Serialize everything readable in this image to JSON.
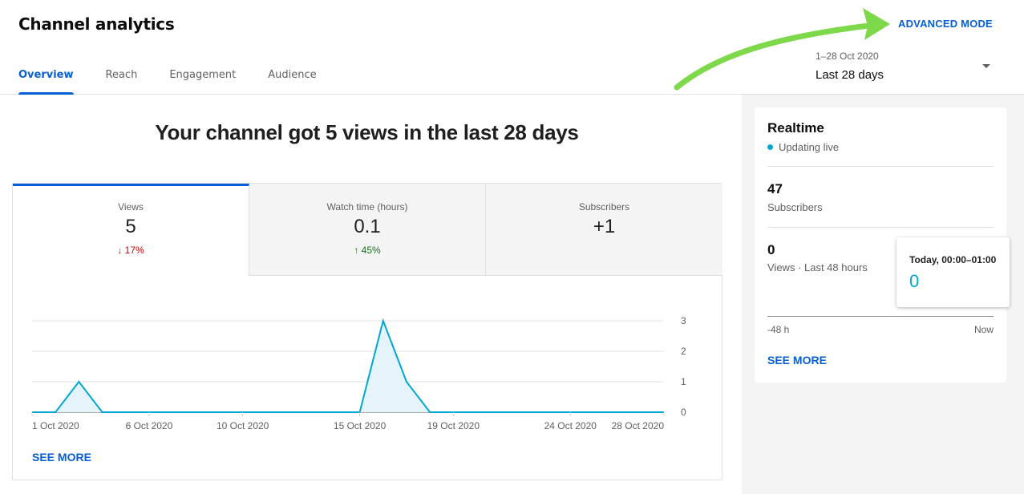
{
  "header": {
    "title": "Channel analytics",
    "tabs": [
      {
        "label": "Overview",
        "active": true
      },
      {
        "label": "Reach",
        "active": false
      },
      {
        "label": "Engagement",
        "active": false
      },
      {
        "label": "Audience",
        "active": false
      }
    ],
    "advanced_mode_label": "ADVANCED MODE",
    "date_range": {
      "dates": "1–28 Oct 2020",
      "selected": "Last 28 days"
    },
    "annotation_color": "#7dd84a"
  },
  "main": {
    "headline": "Your channel got 5 views in the last 28 days",
    "metrics": [
      {
        "label": "Views",
        "value": "5",
        "delta": "17%",
        "direction": "down",
        "active": true
      },
      {
        "label": "Watch time (hours)",
        "value": "0.1",
        "delta": "45%",
        "direction": "up",
        "active": false
      },
      {
        "label": "Subscribers",
        "value": "+1",
        "delta": "",
        "direction": "",
        "active": false
      }
    ],
    "see_more": "SEE MORE"
  },
  "chart_data": {
    "type": "area",
    "title": "",
    "xlabel": "",
    "ylabel": "Views",
    "x": [
      "1 Oct",
      "2 Oct",
      "3 Oct",
      "4 Oct",
      "5 Oct",
      "6 Oct",
      "7 Oct",
      "8 Oct",
      "9 Oct",
      "10 Oct",
      "11 Oct",
      "12 Oct",
      "13 Oct",
      "14 Oct",
      "15 Oct",
      "16 Oct",
      "17 Oct",
      "18 Oct",
      "19 Oct",
      "20 Oct",
      "21 Oct",
      "22 Oct",
      "23 Oct",
      "24 Oct",
      "25 Oct",
      "26 Oct",
      "27 Oct",
      "28 Oct"
    ],
    "values": [
      0,
      0,
      1,
      0,
      0,
      0,
      0,
      0,
      0,
      0,
      0,
      0,
      0,
      0,
      0,
      3,
      1,
      0,
      0,
      0,
      0,
      0,
      0,
      0,
      0,
      0,
      0,
      0
    ],
    "x_tick_labels": [
      {
        "index": 0,
        "label": "1 Oct 2020"
      },
      {
        "index": 5,
        "label": "6 Oct 2020"
      },
      {
        "index": 9,
        "label": "10 Oct 2020"
      },
      {
        "index": 14,
        "label": "15 Oct 2020"
      },
      {
        "index": 18,
        "label": "19 Oct 2020"
      },
      {
        "index": 23,
        "label": "24 Oct 2020"
      },
      {
        "index": 27,
        "label": "28 Oct 2020"
      }
    ],
    "y_ticks": [
      0,
      1,
      2,
      3
    ],
    "ylim": [
      0,
      3
    ],
    "grid": true,
    "y_axis_side": "right",
    "line_color": "#00a7d2",
    "fill_color": "#e5f4fb"
  },
  "realtime": {
    "title": "Realtime",
    "status": "Updating live",
    "subscribers_value": "47",
    "subscribers_label": "Subscribers",
    "views_value": "0",
    "views_label": "Views · Last 48 hours",
    "axis_start": "-48 h",
    "axis_end": "Now",
    "see_more": "SEE MORE",
    "tooltip": {
      "title": "Today, 00:00–01:00",
      "value": "0"
    }
  }
}
